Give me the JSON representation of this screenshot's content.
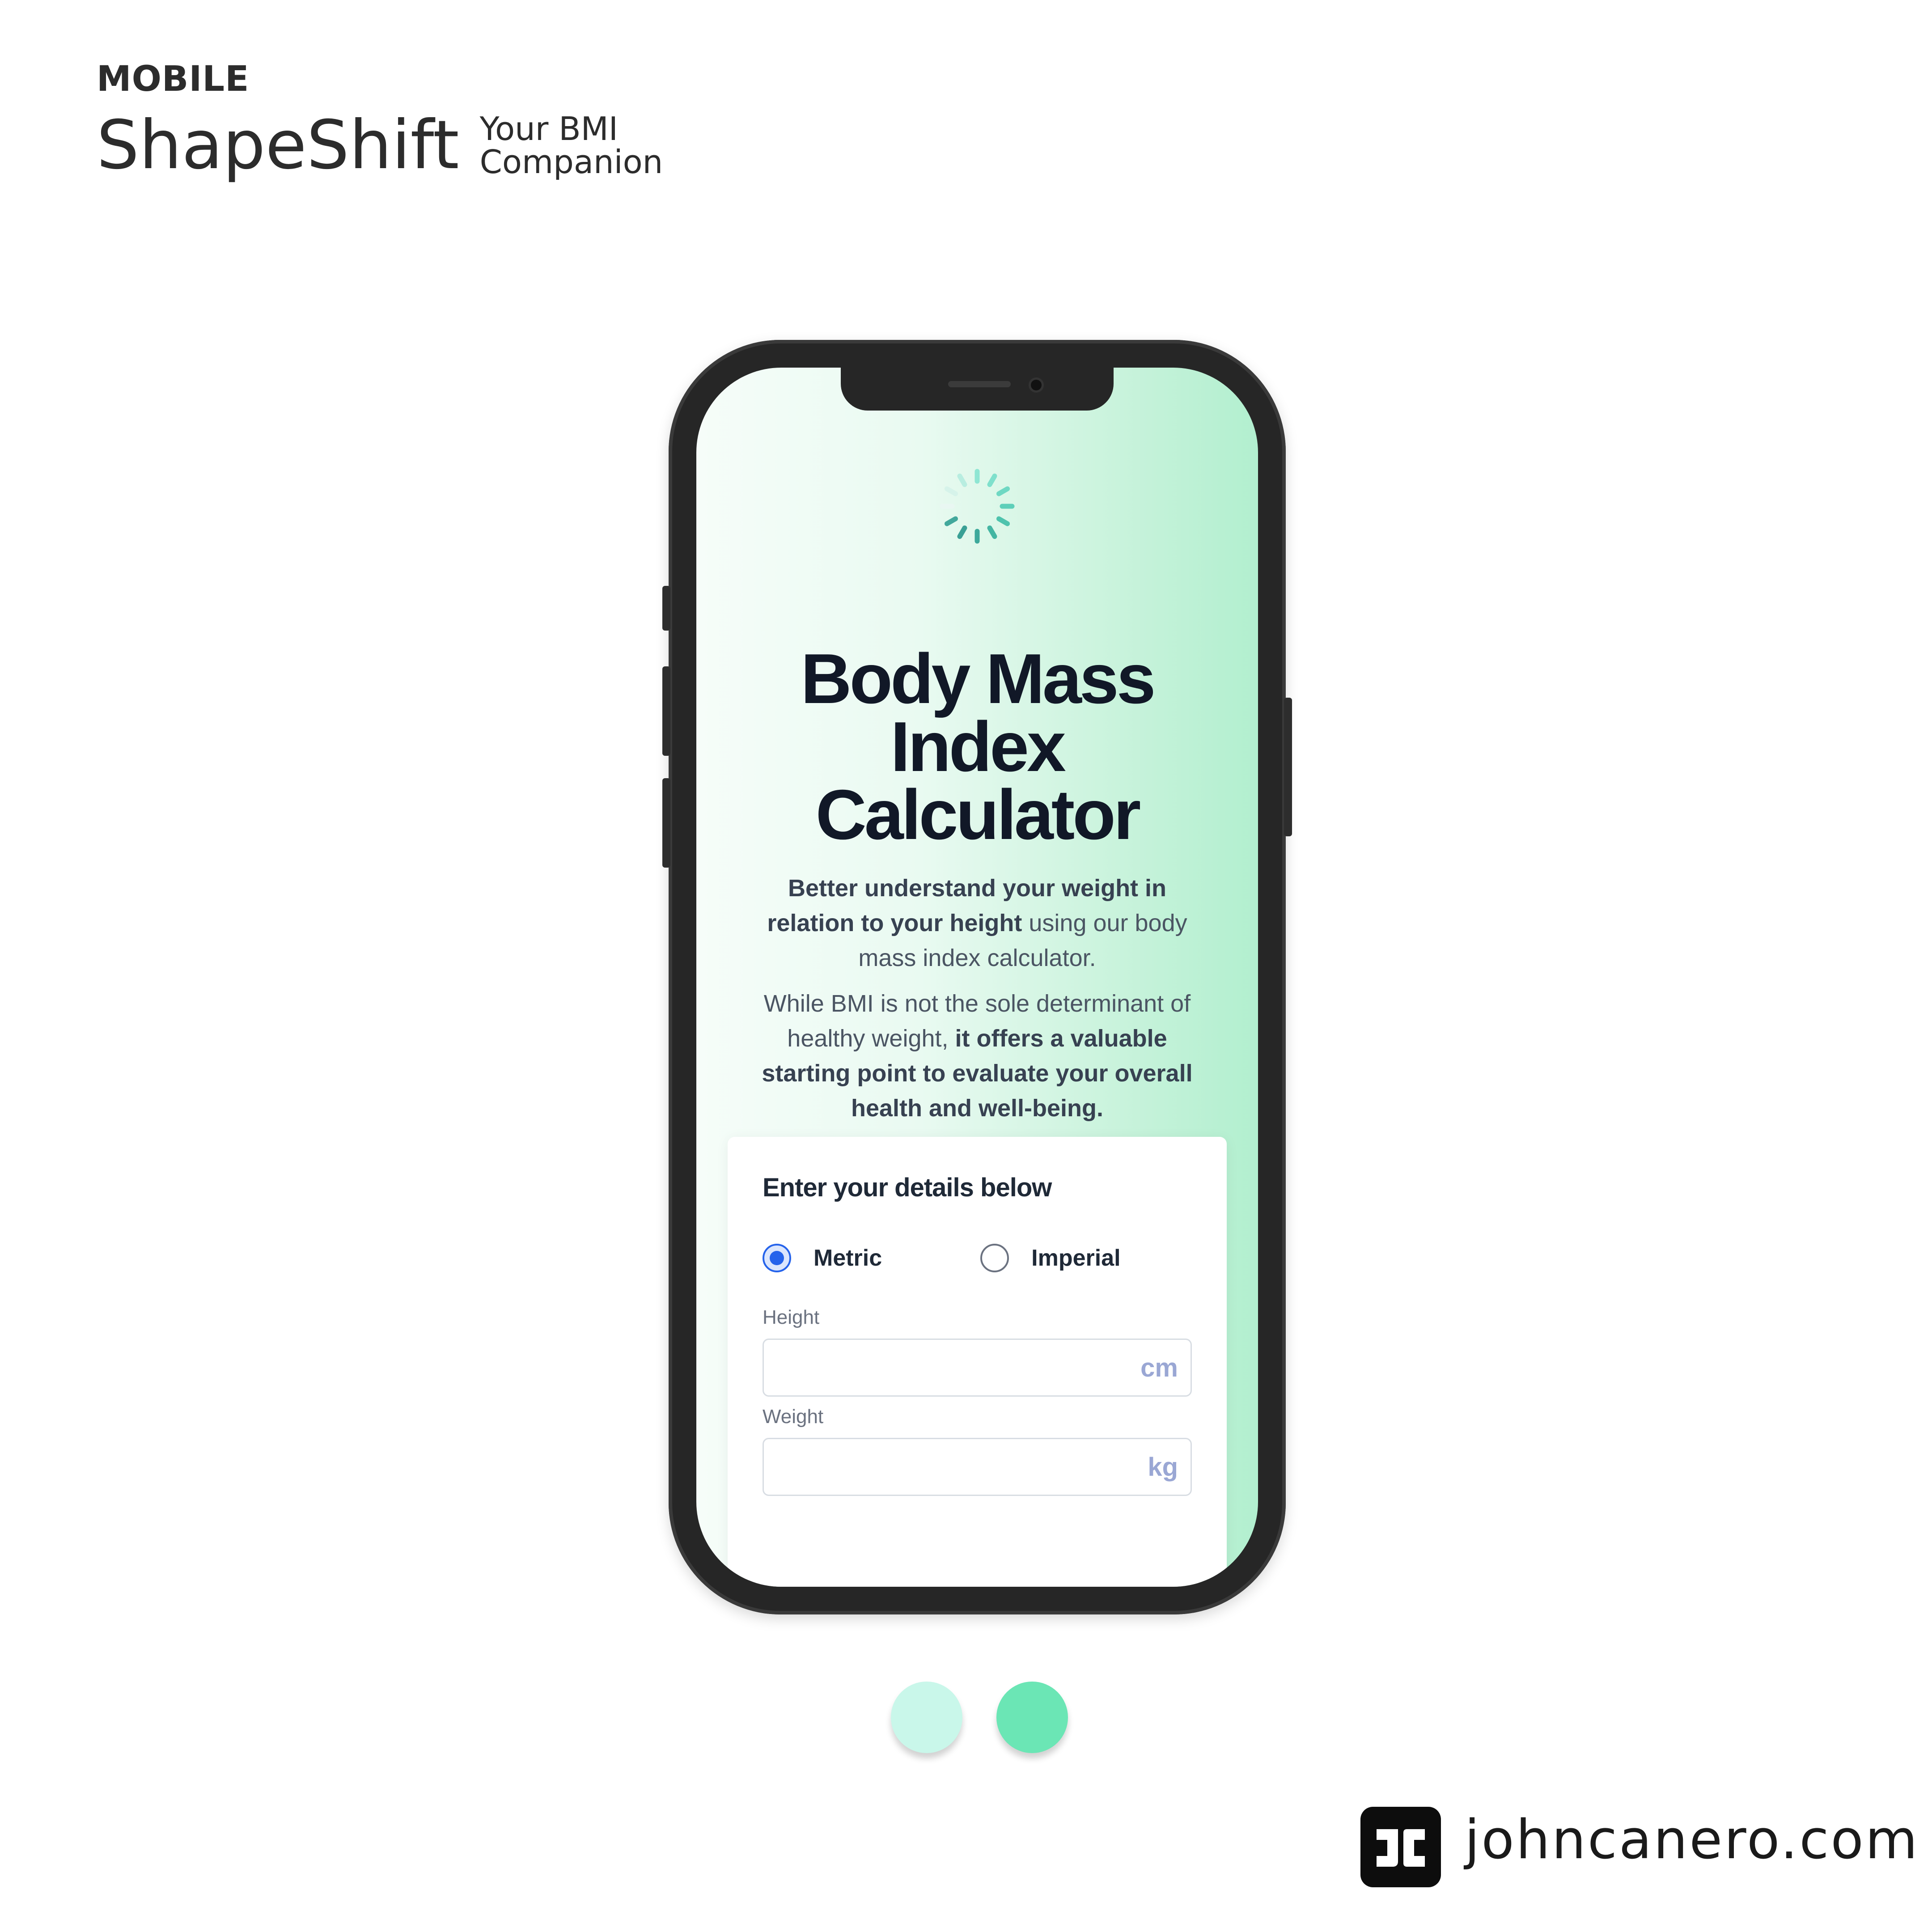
{
  "brand": {
    "kicker": "MOBILE",
    "name": "ShapeShift",
    "tagline_line1": "Your BMI",
    "tagline_line2": "Companion"
  },
  "screen": {
    "title_line1": "Body Mass",
    "title_line2": "Index",
    "title_line3": "Calculator",
    "intro1_bold": "Better understand your weight in relation to your height",
    "intro1_rest": " using our body mass index calculator.",
    "intro2_start": "While BMI is not the sole determinant of healthy weight, ",
    "intro2_bold": "it offers a valuable starting point to evaluate your overall health and well-being.",
    "form": {
      "heading": "Enter your details below",
      "unit_options": [
        {
          "label": "Metric",
          "selected": true
        },
        {
          "label": "Imperial",
          "selected": false
        }
      ],
      "height_label": "Height",
      "height_value": "",
      "height_unit": "cm",
      "weight_label": "Weight",
      "weight_value": "",
      "weight_unit": "kg"
    },
    "icons": {
      "loader": "spinner-icon"
    }
  },
  "palette": {
    "swatch_light": "#c9f7ea",
    "swatch_accent": "#6be6b5"
  },
  "footer": {
    "site": "johncanero.com"
  }
}
